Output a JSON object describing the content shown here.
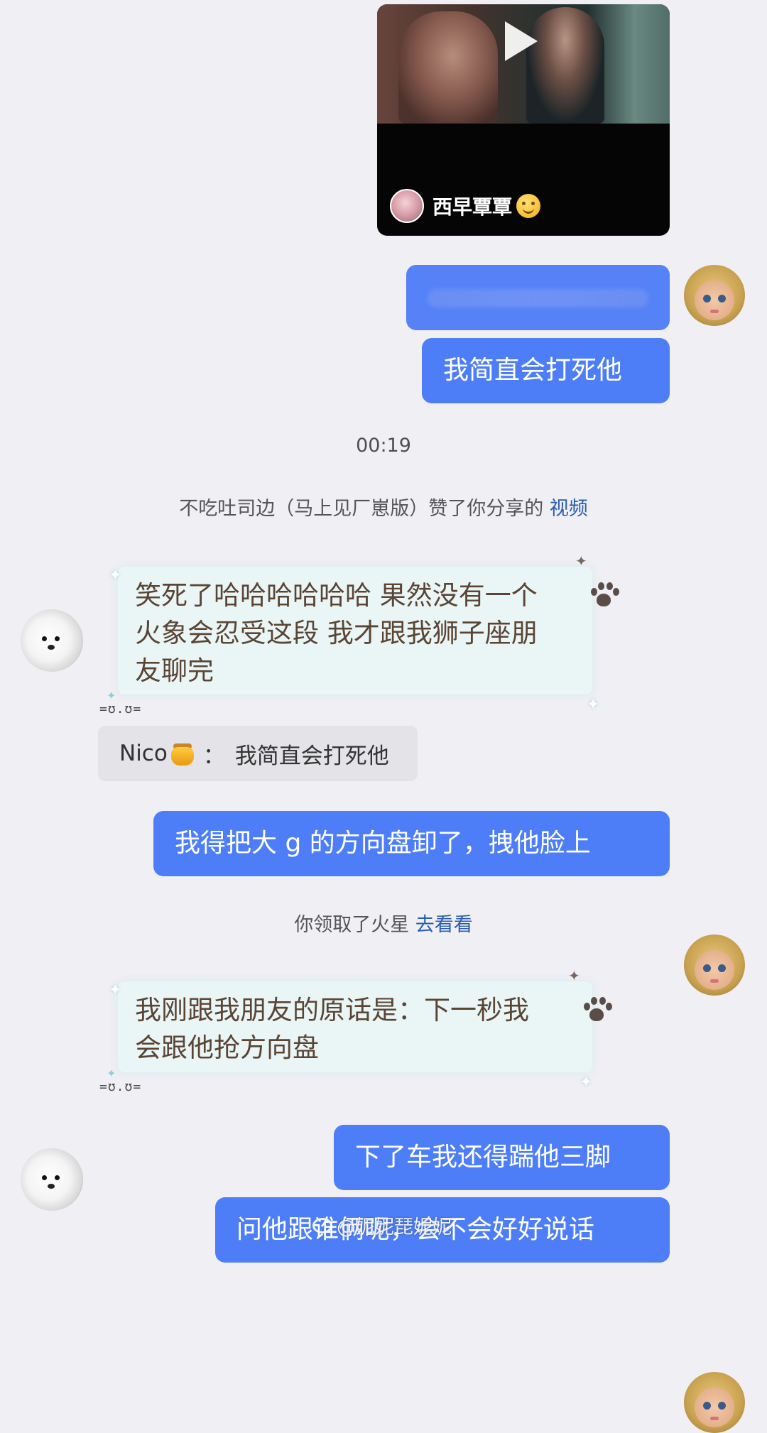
{
  "video_card": {
    "author_name": "西早覃覃",
    "author_emoji": "smile-emoji",
    "play_icon": "play-icon"
  },
  "messages": {
    "sent_1_blurred": "",
    "sent_2": "我简直会打死他",
    "timestamp": "00:19",
    "like_notice_text": "不吃吐司边（马上见厂崽版）赞了你分享的",
    "like_notice_link": "视频",
    "received_1_line1": "笑死了哈哈哈哈哈哈 果然没有一个",
    "received_1_line2": "火象会忍受这段 我才跟我狮子座朋",
    "received_1_line3": "友聊完",
    "quote_name": "Nico",
    "quote_colon": "：",
    "quote_text": "我简直会打死他",
    "sent_3": "我得把大 g 的方向盘卸了，拽他脸上",
    "mars_notice_text": "你领取了火星",
    "mars_notice_link": "去看看",
    "received_2_line1": "我刚跟我朋友的原话是：下一秒我",
    "received_2_line2": "会跟他抢方向盘",
    "sent_4": "下了车我还得踹他三脚",
    "sent_5": "问他跟谁俩呢，会不会好好说话"
  },
  "decorations": {
    "bubble_face": "=ʊ.ʊ="
  },
  "watermark": {
    "text": "@妮妮琵妮妮"
  },
  "colors": {
    "background": "#efeff4",
    "sent_bubble": "#4d7ef7",
    "received_bubble": "#eaf6f6",
    "link": "#2a5db0"
  }
}
